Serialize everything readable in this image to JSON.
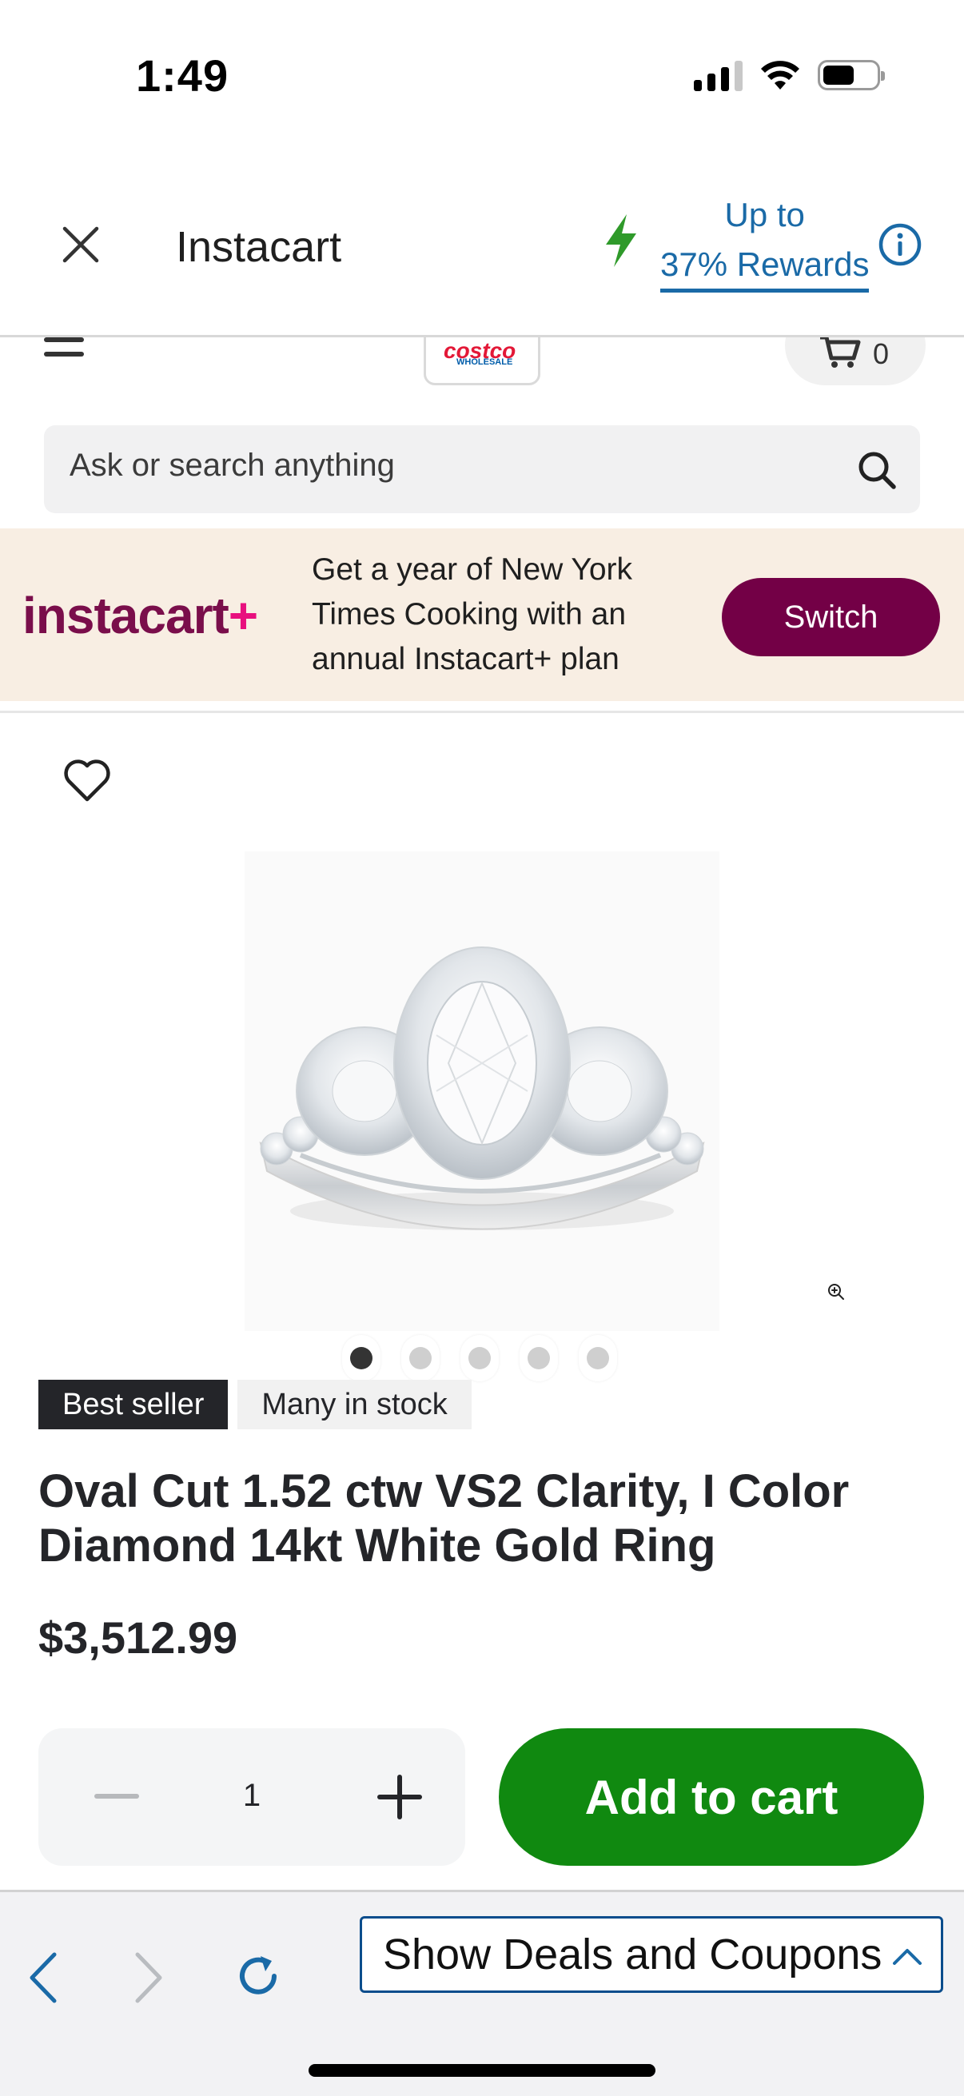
{
  "status_bar": {
    "time": "1:49"
  },
  "header": {
    "title": "Instacart",
    "rewards_line1": "Up to",
    "rewards_line2": "37% Rewards"
  },
  "store_nav": {
    "cart_count": "0",
    "store_name": "Costco Wholesale"
  },
  "search": {
    "placeholder": "Ask or search anything"
  },
  "promo": {
    "logo_text": "instacart",
    "logo_plus": "+",
    "text": "Get a year of New York Times Cooking with an annual Instacart+ plan",
    "button_label": "Switch"
  },
  "product": {
    "badges": [
      "Best seller",
      "Many in stock"
    ],
    "title": "Oval Cut 1.52 ctw VS2 Clarity, I Color Diamond 14kt White Gold Ring",
    "price": "$3,512.99",
    "quantity": "1",
    "add_to_cart_label": "Add to cart",
    "image_count": 5,
    "active_image": 1
  },
  "browser_bar": {
    "deals_label": "Show Deals and Coupons"
  },
  "colors": {
    "accent_green": "#108910",
    "rewards_blue": "#1a6aa7",
    "promo_purple": "#730046",
    "promo_bg": "#f8eee3"
  }
}
